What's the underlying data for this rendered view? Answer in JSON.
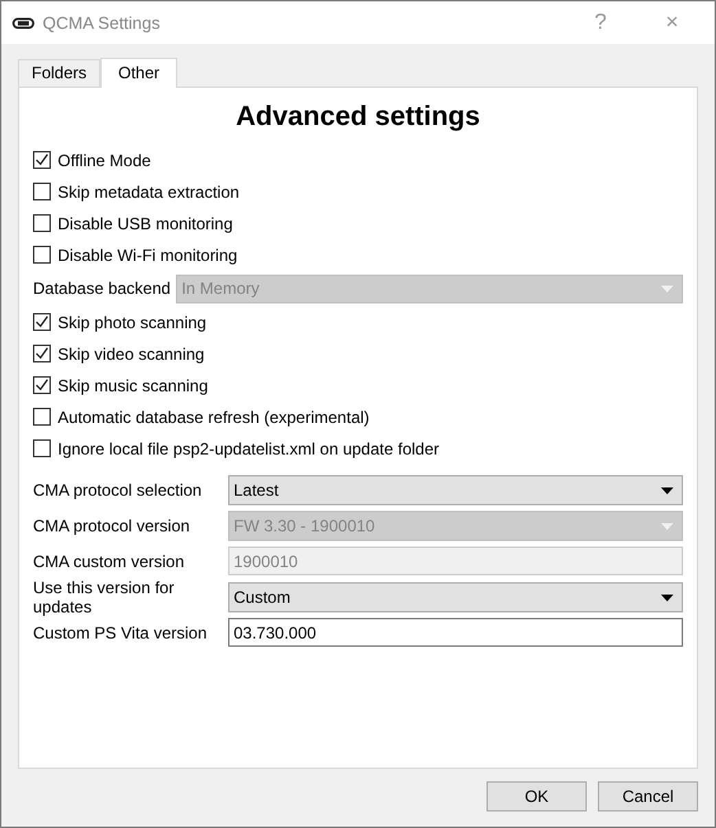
{
  "window": {
    "title": "QCMA Settings",
    "help": "?",
    "close": "×"
  },
  "tabs": [
    {
      "label": "Folders",
      "selected": false
    },
    {
      "label": "Other",
      "selected": true
    }
  ],
  "heading": "Advanced settings",
  "options": [
    {
      "kind": "checkbox",
      "label": "Offline Mode",
      "checked": true
    },
    {
      "kind": "checkbox",
      "label": "Skip metadata extraction",
      "checked": false
    },
    {
      "kind": "checkbox",
      "label": "Disable USB monitoring",
      "checked": false
    },
    {
      "kind": "checkbox",
      "label": "Disable Wi-Fi monitoring",
      "checked": false
    },
    {
      "kind": "select",
      "label": "Database backend",
      "value": "In Memory",
      "disabled": true
    },
    {
      "kind": "checkbox",
      "label": "Skip photo scanning",
      "checked": true
    },
    {
      "kind": "checkbox",
      "label": "Skip video scanning",
      "checked": true
    },
    {
      "kind": "checkbox",
      "label": "Skip music scanning",
      "checked": true
    },
    {
      "kind": "checkbox",
      "label": "Automatic database refresh (experimental)",
      "checked": false
    },
    {
      "kind": "checkbox",
      "label": "Ignore local file psp2-updatelist.xml on update folder",
      "checked": false
    }
  ],
  "form": [
    {
      "kind": "select",
      "label": "CMA protocol selection",
      "value": "Latest",
      "disabled": false
    },
    {
      "kind": "select",
      "label": "CMA protocol version",
      "value": "FW 3.30 - 1900010",
      "disabled": true
    },
    {
      "kind": "text",
      "label": "CMA custom version",
      "value": "1900010",
      "disabled": true
    },
    {
      "kind": "select",
      "label": "Use this version for updates",
      "value": "Custom",
      "disabled": false
    },
    {
      "kind": "text",
      "label": "Custom PS Vita version",
      "value": "03.730.000",
      "disabled": false
    }
  ],
  "buttons": [
    "OK",
    "Cancel"
  ]
}
